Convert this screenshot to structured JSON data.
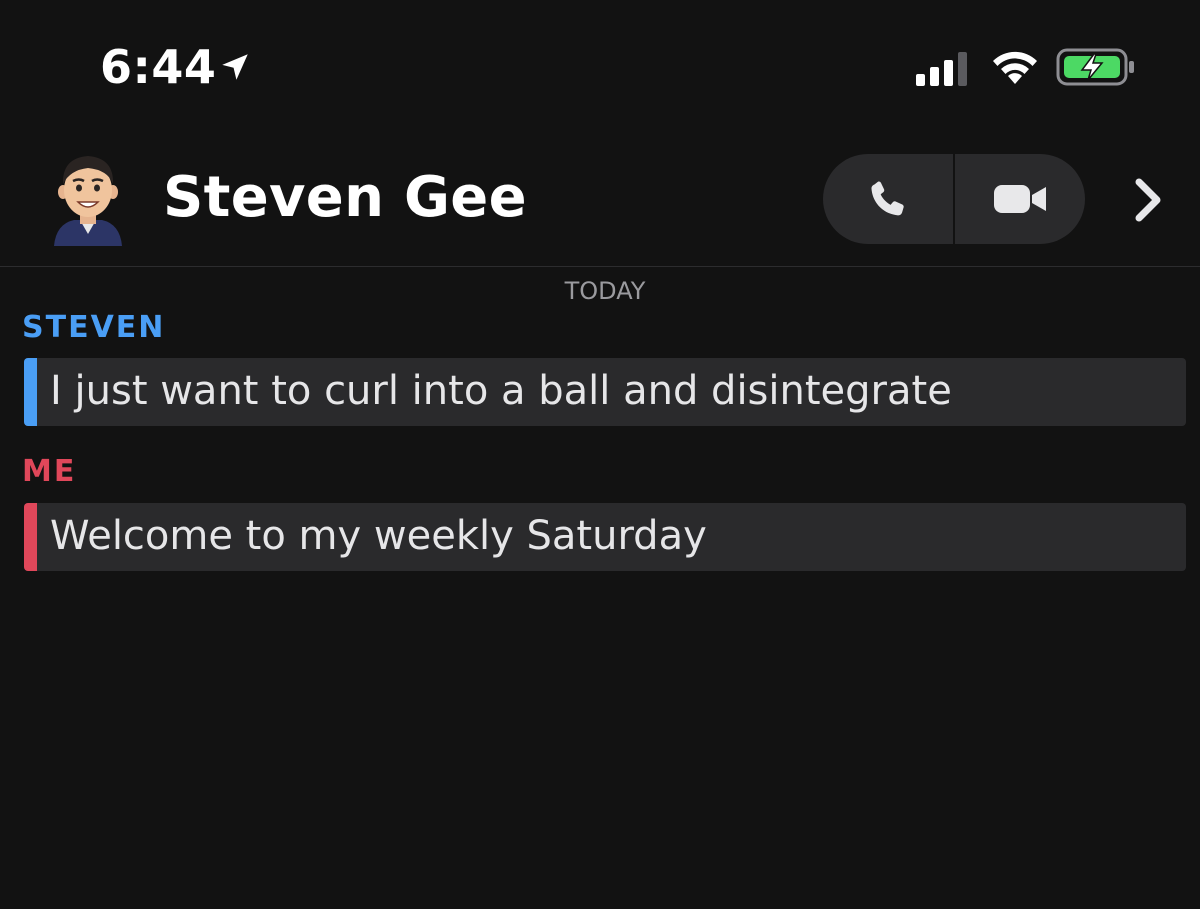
{
  "status_bar": {
    "time": "6:44",
    "icons": [
      "location-arrow-icon",
      "cellular-signal-icon",
      "wifi-icon",
      "battery-charging-icon"
    ],
    "battery_color": "#4cd964"
  },
  "header": {
    "contact_name": "Steven Gee",
    "avatar": "bitmoji-avatar",
    "actions": {
      "phone": "phone-icon",
      "video": "video-camera-icon",
      "more": "chevron-right-icon"
    }
  },
  "chat": {
    "date_label": "TODAY",
    "messages": [
      {
        "sender": "STEVEN",
        "text": "I just want to curl into a ball and disintegrate",
        "color": "#4a9ef5"
      },
      {
        "sender": "ME",
        "text": "Welcome to my weekly Saturday",
        "color": "#e0475a"
      }
    ]
  },
  "colors": {
    "background": "#121212",
    "bubble": "#2a2a2c",
    "steven_accent": "#4a9ef5",
    "me_accent": "#e0475a"
  }
}
